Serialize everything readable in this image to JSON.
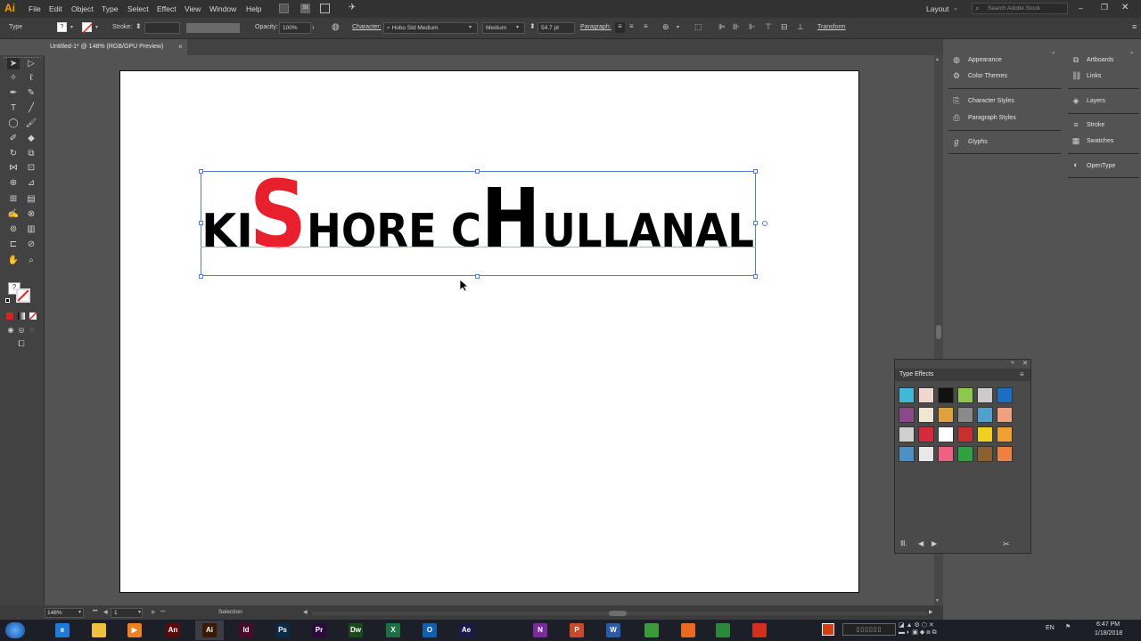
{
  "app": {
    "logo": "Ai"
  },
  "menu": [
    "File",
    "Edit",
    "Object",
    "Type",
    "Select",
    "Effect",
    "View",
    "Window",
    "Help"
  ],
  "menu_right": {
    "workspace": "Layout",
    "search_placeholder": "Search Adobe Stock"
  },
  "control": {
    "mode": "Type",
    "stroke_label": "Stroke:",
    "opacity_label": "Opacity:",
    "opacity_value": "100%",
    "character_label": "Character:",
    "font": "Hobo Std Medium",
    "style": "Medium",
    "size": "54.7 pt",
    "paragraph_label": "Paragraph:",
    "transform_label": "Transform"
  },
  "document": {
    "tab_title": "Untitled-1* @ 148% (RGB/GPU Preview)",
    "close": "×"
  },
  "artwork": {
    "text_parts": [
      "KI",
      "S",
      "HORE C",
      "H",
      "ULLANAL"
    ],
    "highlight_color": "#e8202e",
    "base_color": "#000000"
  },
  "panels": {
    "col1": [
      "Appearance",
      "Color Themes",
      "Character Styles",
      "Paragraph Styles",
      "Glyphs"
    ],
    "col2": [
      "Artboards",
      "Links",
      "Layers",
      "Stroke",
      "Swatches",
      "OpenType"
    ]
  },
  "type_effects": {
    "title": "Type Effects",
    "swatch_colors": [
      "#41b8d8",
      "#f0d8d0",
      "#111111",
      "#8cc84b",
      "#cccccc",
      "#1a6fc4",
      "#8a4a8a",
      "#efe6d4",
      "#e0a040",
      "#8a8a8a",
      "#50a0d0",
      "#f0a080",
      "#d0d0d0",
      "#d8283c",
      "#ffffff",
      "#c83030",
      "#f0d020",
      "#f0a030",
      "#5090c0",
      "#e8e8e8",
      "#f06080",
      "#30a040",
      "#8a6030",
      "#f08040"
    ]
  },
  "status": {
    "zoom": "148%",
    "artboard": "1",
    "tool": "Selection"
  },
  "taskbar": {
    "apps": [
      {
        "label": "e",
        "color": "#1f7bd8"
      },
      {
        "label": "",
        "color": "#f0c040"
      },
      {
        "label": "▶",
        "color": "#f08020"
      },
      {
        "label": "An",
        "color": "#5a0a0a"
      },
      {
        "label": "Ai",
        "color": "#3a1a00"
      },
      {
        "label": "Id",
        "color": "#4a0a2a"
      },
      {
        "label": "Ps",
        "color": "#0a2a4a"
      },
      {
        "label": "Pr",
        "color": "#2a0a3a"
      },
      {
        "label": "Dw",
        "color": "#1a4a1a"
      },
      {
        "label": "X",
        "color": "#1d7044"
      },
      {
        "label": "O",
        "color": "#1060b0"
      },
      {
        "label": "Ae",
        "color": "#1a1a4a"
      },
      {
        "label": "N",
        "color": "#7a2a9a"
      },
      {
        "label": "P",
        "color": "#c84a2a"
      },
      {
        "label": "W",
        "color": "#2a5aa8"
      },
      {
        "label": "",
        "color": "#3a9a3a"
      },
      {
        "label": "",
        "color": "#e86a20"
      },
      {
        "label": "",
        "color": "#2a8a3a"
      },
      {
        "label": "",
        "color": "#d03020"
      }
    ],
    "lang": "EN",
    "time": "6:47 PM",
    "date": "1/18/2018"
  }
}
